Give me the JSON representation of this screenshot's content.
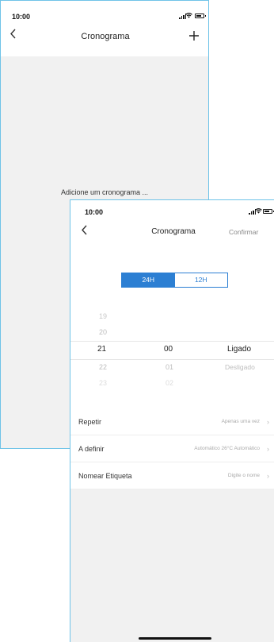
{
  "back_screen": {
    "status_time": "10:00",
    "nav": {
      "back_icon": "chevron-left-icon",
      "title": "Cronograma",
      "add_icon": "plus-icon"
    },
    "empty_message": "Adicione um cronograma ..."
  },
  "front_screen": {
    "status_time": "10:00",
    "nav": {
      "back_icon": "chevron-left-icon",
      "title": "Cronograma",
      "confirm_label": "Confirmar"
    },
    "format_toggle": {
      "options": [
        "24H",
        "12H"
      ],
      "selected": "24H"
    },
    "picker": {
      "hours": [
        "19",
        "20",
        "21",
        "22",
        "23"
      ],
      "minutes": [
        "00",
        "01",
        "02"
      ],
      "states": [
        "Ligado",
        "Desligado"
      ],
      "selected": {
        "hour": "21",
        "minute": "00",
        "state": "Ligado"
      }
    },
    "settings": [
      {
        "label": "Repetir",
        "value": "Apenas uma vez"
      },
      {
        "label": "A definir",
        "value": "Automático 26°C Automático"
      },
      {
        "label": "Nomear Etiqueta",
        "value": "Digite o nome"
      }
    ]
  },
  "colors": {
    "accent": "#2c7fd3",
    "frame": "#6fc3e8",
    "background": "#f1f1f1"
  }
}
